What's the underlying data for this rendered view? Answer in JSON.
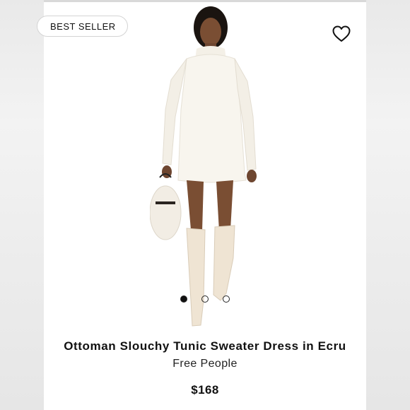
{
  "badge": {
    "label": "BEST SELLER"
  },
  "icons": {
    "favorite": "heart-outline-icon"
  },
  "carousel": {
    "total": 3,
    "active_index": 1
  },
  "product": {
    "title": "Ottoman Slouchy Tunic Sweater Dress in Ecru",
    "brand": "Free People",
    "price": "$168"
  },
  "colors": {
    "dress": "#f8f5ee",
    "boots": "#efe4d3",
    "text": "#111111"
  }
}
